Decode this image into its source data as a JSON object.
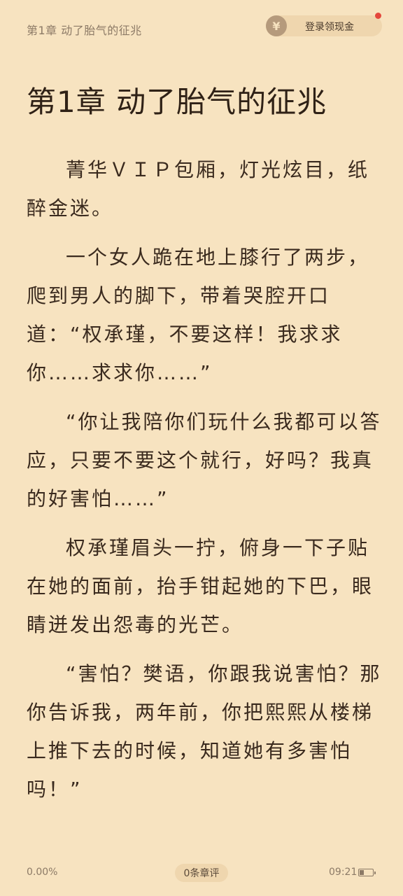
{
  "header": {
    "chapter_small": "第1章 动了胎气的征兆",
    "login_button": "登录领现金",
    "coin_symbol": "¥"
  },
  "chapter": {
    "title": "第1章 动了胎气的征兆",
    "paragraphs": [
      "菁华ＶＩＰ包厢，灯光炫目，纸醉金迷。",
      "一个女人跪在地上膝行了两步，爬到男人的脚下，带着哭腔开口道：“权承瑾，不要这样！我求求你……求求你……”",
      "“你让我陪你们玩什么我都可以答应，只要不要这个就行，好吗？我真的好害怕……”",
      "权承瑾眉头一拧，俯身一下子贴在她的面前，抬手钳起她的下巴，眼睛迸发出怨毒的光芒。",
      "“害怕？樊语，你跟我说害怕？那你告诉我，两年前，你把熙熙从楼梯上推下去的时候，知道她有多害怕吗！”"
    ]
  },
  "footer": {
    "progress": "0.00%",
    "comments": "0条章评",
    "time": "09:21",
    "battery_level": 0.35
  },
  "colors": {
    "background": "#f7e3c0",
    "text": "#3a2a1e",
    "muted": "#8c7a66",
    "notification_dot": "#e4473c"
  }
}
